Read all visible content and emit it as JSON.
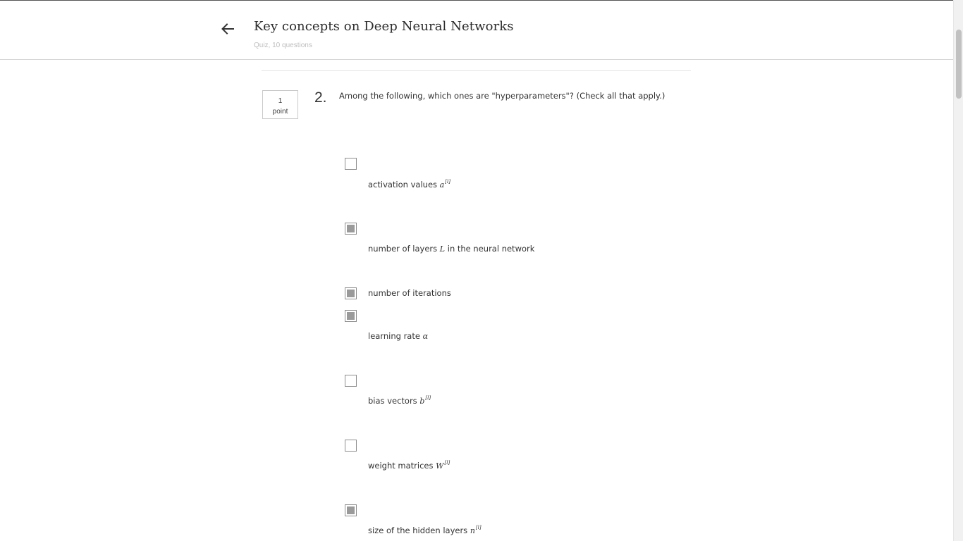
{
  "header": {
    "title": "Key concepts on Deep Neural Networks",
    "subtitle": "Quiz, 10 questions"
  },
  "question": {
    "points_value": "1",
    "points_unit": "point",
    "number": "2.",
    "text": "Among the following, which ones are \"hyperparameters\"? (Check all that apply.)"
  },
  "options": [
    {
      "label": "activation values",
      "math": "a",
      "sup": "[l]",
      "checked": false
    },
    {
      "label": "number of layers",
      "math": "L",
      "suffix": "in the neural network",
      "checked": true
    },
    {
      "label": "number of iterations",
      "checked": true
    },
    {
      "label": "learning rate",
      "math": "α",
      "checked": true
    },
    {
      "label": "bias vectors",
      "math": "b",
      "sup": "[l]",
      "checked": false
    },
    {
      "label": "weight matrices",
      "math": "W",
      "sup": "[l]",
      "checked": false
    },
    {
      "label": "size of the hidden layers",
      "math": "n",
      "sup": "[l]",
      "checked": true
    }
  ],
  "icons": {
    "back": "arrow-left-icon"
  }
}
